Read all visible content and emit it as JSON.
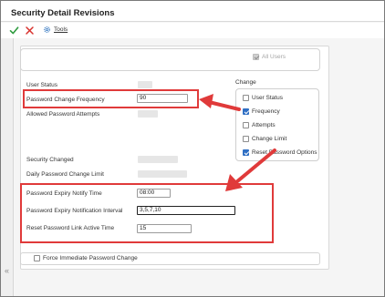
{
  "window": {
    "title": "Security Detail Revisions"
  },
  "toolbar": {
    "ok_icon": "checkmark-icon",
    "cancel_icon": "close-icon",
    "tools_label": "Tools",
    "tools_icon": "gear-icon"
  },
  "all_users": {
    "label": "All Users",
    "checked": true,
    "enabled": false
  },
  "fields": {
    "user_status_label": "User Status",
    "password_change_frequency_label": "Password Change Frequency",
    "password_change_frequency_value": "90",
    "allowed_password_attempts_label": "Allowed Password Attempts",
    "security_changed_label": "Security Changed",
    "daily_password_change_limit_label": "Daily Password Change Limit",
    "password_expiry_notify_time_label": "Password Expiry Notify Time",
    "password_expiry_notify_time_value": "08:00",
    "password_expiry_notification_interval_label": "Password Expiry Notification Interval",
    "password_expiry_notification_interval_value": "3,5,7,10",
    "reset_password_link_active_time_label": "Reset Password Link Active Time",
    "reset_password_link_active_time_value": "15"
  },
  "change_group": {
    "title": "Change",
    "options": [
      {
        "label": "User Status",
        "checked": false
      },
      {
        "label": "Frequency",
        "checked": true
      },
      {
        "label": "Attempts",
        "checked": false
      },
      {
        "label": "Change Limit",
        "checked": false
      },
      {
        "label": "Reset Password Options",
        "checked": true
      }
    ]
  },
  "force_change": {
    "label": "Force Immediate Password Change",
    "checked": false
  },
  "annotations": {
    "highlight_color": "#e03a3a",
    "arrow_color": "#e03a3a"
  },
  "colors": {
    "checkbox_checked": "#2f6fc4",
    "panel_bg": "#ffffff",
    "page_bg": "#f5f5f5"
  }
}
